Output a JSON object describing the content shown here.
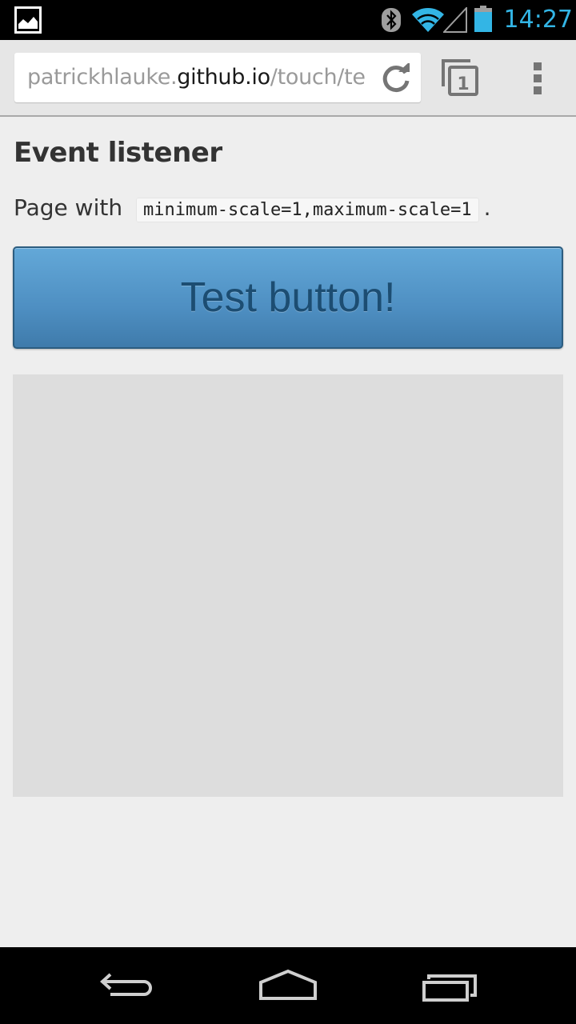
{
  "status_bar": {
    "time": "14:27",
    "icons": [
      "gallery-icon",
      "bluetooth-icon",
      "wifi-icon",
      "signal-icon",
      "battery-icon"
    ],
    "clock_color": "#33b5e5"
  },
  "browser": {
    "url_prefix": "patrickhlauke.",
    "url_host": "github.io",
    "url_suffix": "/touch/te",
    "tab_count": "1",
    "icons": [
      "reload-icon",
      "tabs-icon",
      "overflow-menu-icon"
    ]
  },
  "page": {
    "title": "Event listener",
    "desc_prefix": "Page with",
    "desc_code": "minimum-scale=1,maximum-scale=1",
    "desc_suffix": ".",
    "button_label": "Test button!",
    "button_color": "#4e8fc2"
  },
  "nav_bar": {
    "icons": [
      "back-icon",
      "home-icon",
      "recent-apps-icon"
    ]
  }
}
